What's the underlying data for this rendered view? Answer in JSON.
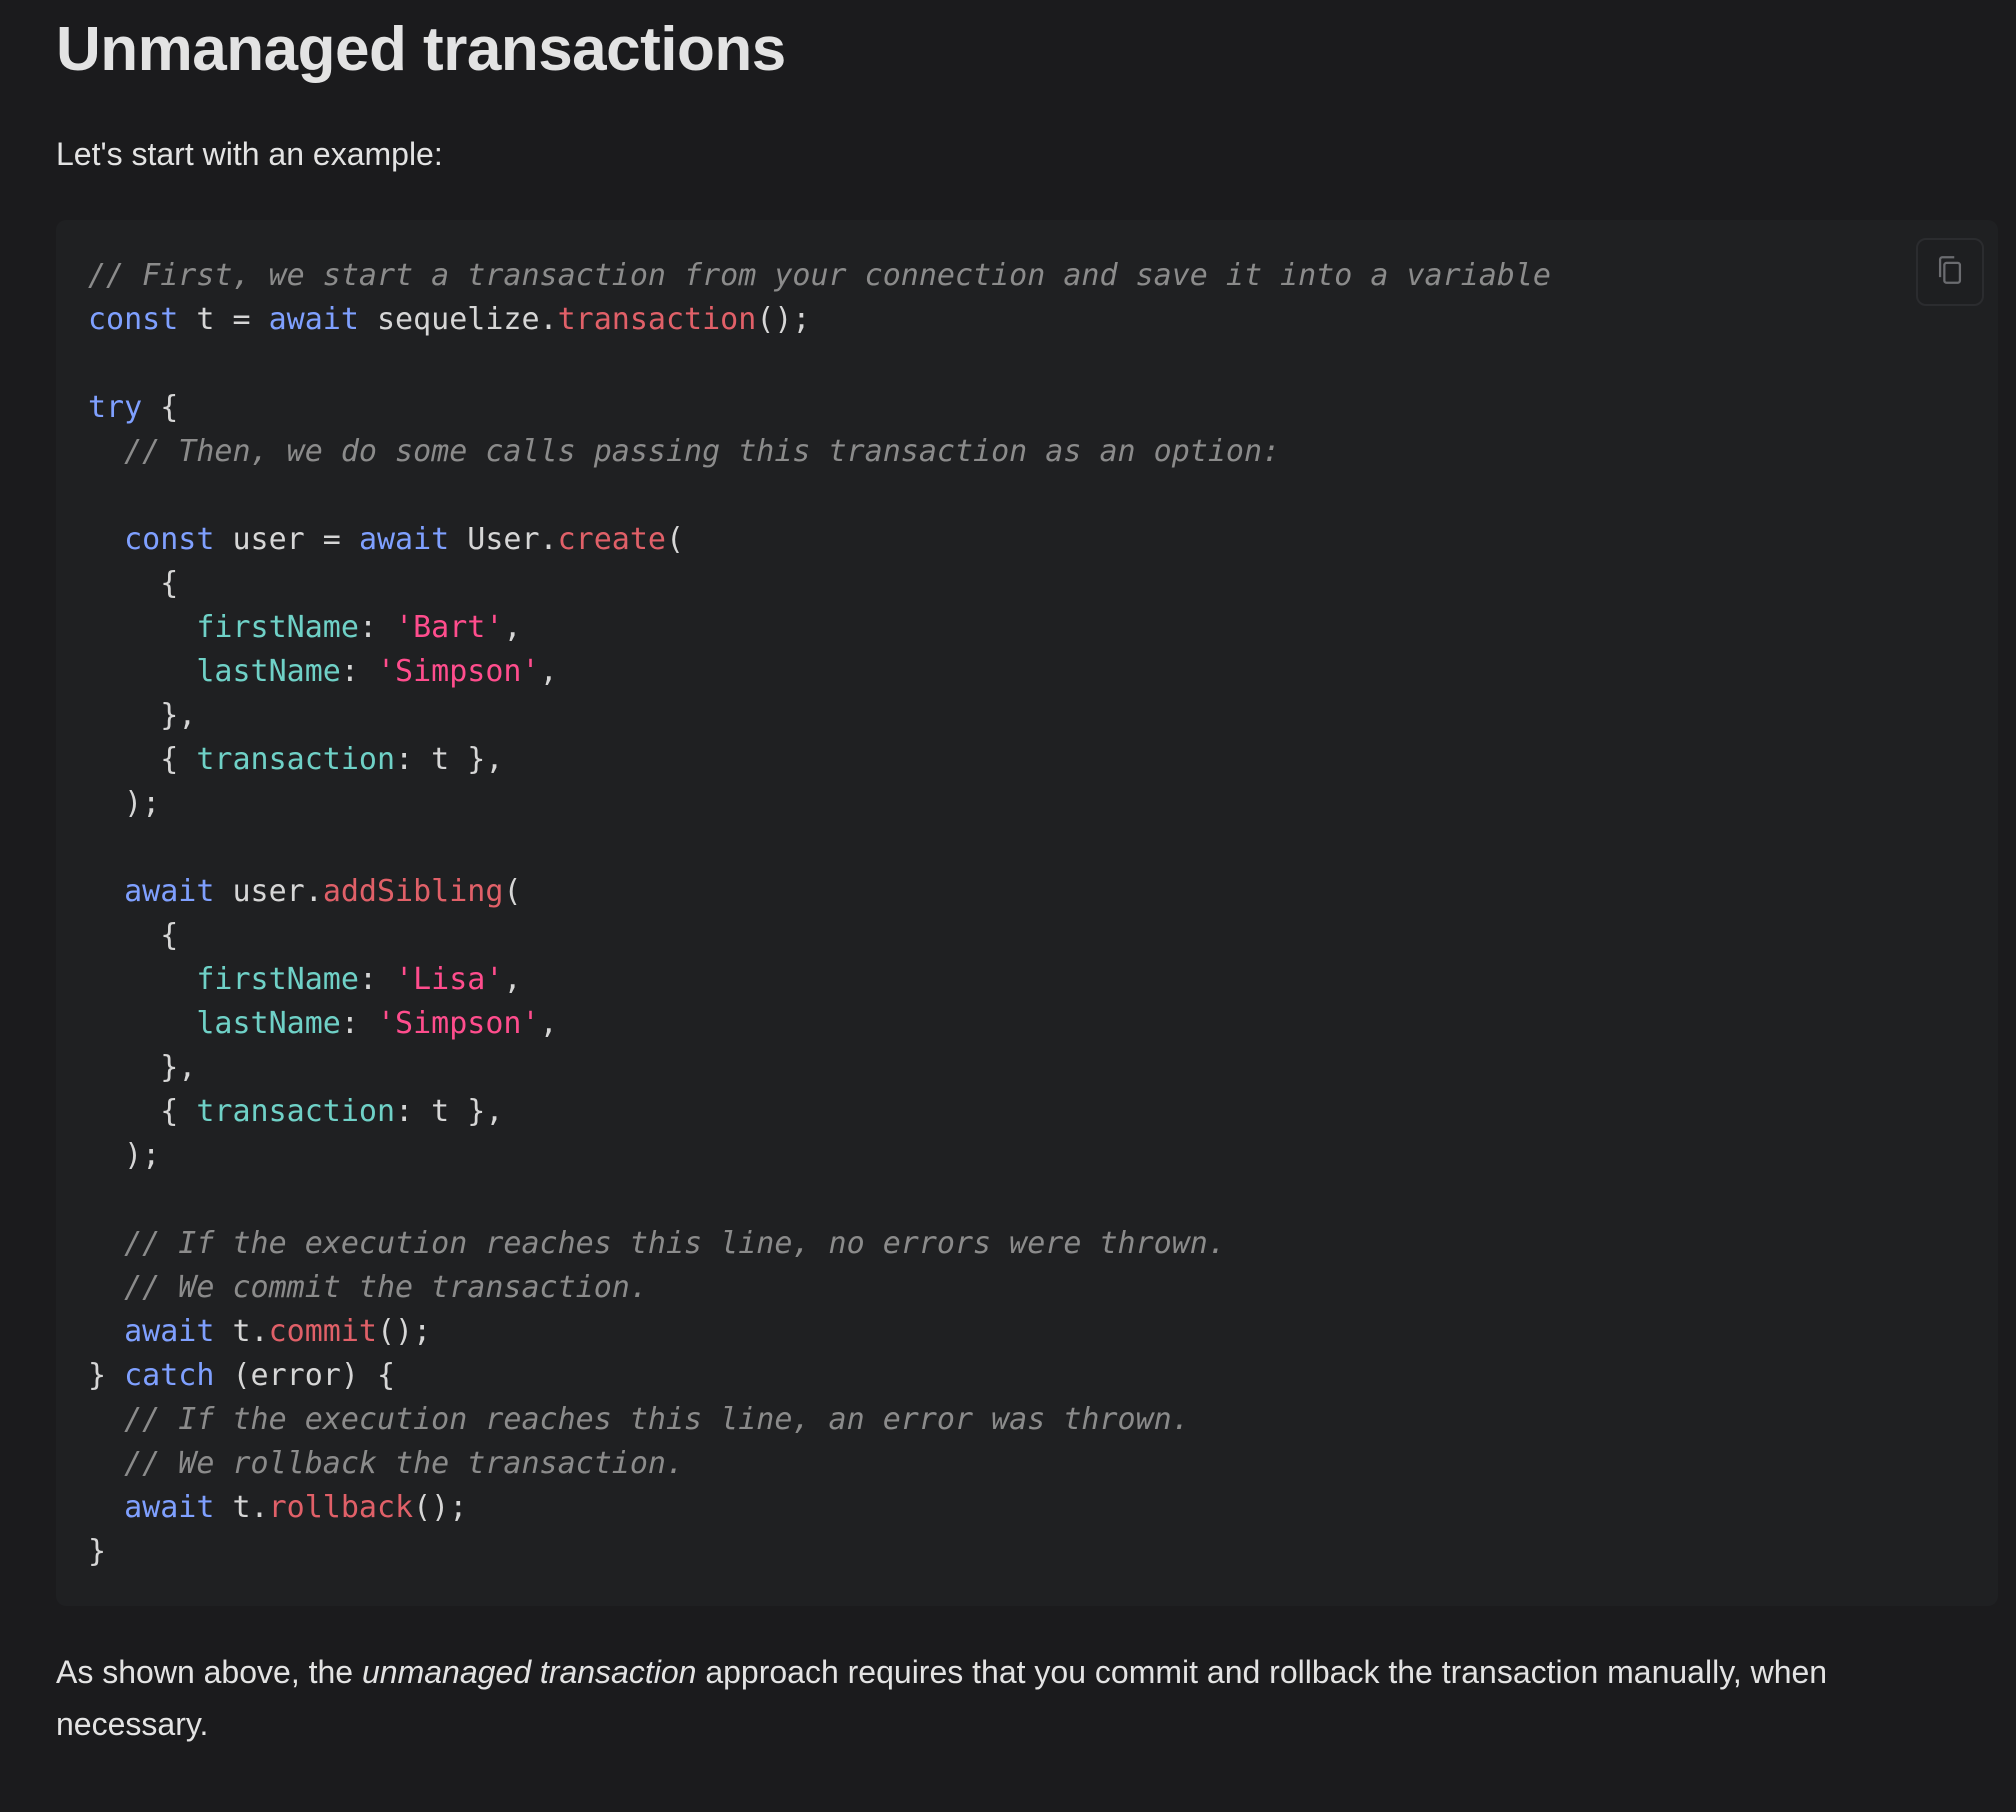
{
  "heading": "Unmanaged transactions",
  "intro": "Let's start with an example:",
  "code": {
    "language": "javascript",
    "copy_icon": "copy-icon",
    "lines": [
      [
        [
          "comment",
          "// First, we start a transaction from your connection and save it into a variable"
        ]
      ],
      [
        [
          "keyword",
          "const"
        ],
        [
          "plain",
          " t = "
        ],
        [
          "keyword",
          "await"
        ],
        [
          "plain",
          " sequelize."
        ],
        [
          "func",
          "transaction"
        ],
        [
          "plain",
          "();"
        ]
      ],
      [],
      [
        [
          "keyword",
          "try"
        ],
        [
          "plain",
          " {"
        ]
      ],
      [
        [
          "plain",
          "  "
        ],
        [
          "comment",
          "// Then, we do some calls passing this transaction as an option:"
        ]
      ],
      [],
      [
        [
          "plain",
          "  "
        ],
        [
          "keyword",
          "const"
        ],
        [
          "plain",
          " user = "
        ],
        [
          "keyword",
          "await"
        ],
        [
          "plain",
          " User."
        ],
        [
          "func",
          "create"
        ],
        [
          "plain",
          "("
        ]
      ],
      [
        [
          "plain",
          "    {"
        ]
      ],
      [
        [
          "plain",
          "      "
        ],
        [
          "prop",
          "firstName"
        ],
        [
          "plain",
          ": "
        ],
        [
          "string",
          "'Bart'"
        ],
        [
          "plain",
          ","
        ]
      ],
      [
        [
          "plain",
          "      "
        ],
        [
          "prop",
          "lastName"
        ],
        [
          "plain",
          ": "
        ],
        [
          "string",
          "'Simpson'"
        ],
        [
          "plain",
          ","
        ]
      ],
      [
        [
          "plain",
          "    },"
        ]
      ],
      [
        [
          "plain",
          "    { "
        ],
        [
          "prop",
          "transaction"
        ],
        [
          "plain",
          ": t },"
        ]
      ],
      [
        [
          "plain",
          "  );"
        ]
      ],
      [],
      [
        [
          "plain",
          "  "
        ],
        [
          "keyword",
          "await"
        ],
        [
          "plain",
          " user."
        ],
        [
          "func",
          "addSibling"
        ],
        [
          "plain",
          "("
        ]
      ],
      [
        [
          "plain",
          "    {"
        ]
      ],
      [
        [
          "plain",
          "      "
        ],
        [
          "prop",
          "firstName"
        ],
        [
          "plain",
          ": "
        ],
        [
          "string",
          "'Lisa'"
        ],
        [
          "plain",
          ","
        ]
      ],
      [
        [
          "plain",
          "      "
        ],
        [
          "prop",
          "lastName"
        ],
        [
          "plain",
          ": "
        ],
        [
          "string",
          "'Simpson'"
        ],
        [
          "plain",
          ","
        ]
      ],
      [
        [
          "plain",
          "    },"
        ]
      ],
      [
        [
          "plain",
          "    { "
        ],
        [
          "prop",
          "transaction"
        ],
        [
          "plain",
          ": t },"
        ]
      ],
      [
        [
          "plain",
          "  );"
        ]
      ],
      [],
      [
        [
          "plain",
          "  "
        ],
        [
          "comment",
          "// If the execution reaches this line, no errors were thrown."
        ]
      ],
      [
        [
          "plain",
          "  "
        ],
        [
          "comment",
          "// We commit the transaction."
        ]
      ],
      [
        [
          "plain",
          "  "
        ],
        [
          "keyword",
          "await"
        ],
        [
          "plain",
          " t."
        ],
        [
          "func",
          "commit"
        ],
        [
          "plain",
          "();"
        ]
      ],
      [
        [
          "plain",
          "} "
        ],
        [
          "keyword",
          "catch"
        ],
        [
          "plain",
          " (error) {"
        ]
      ],
      [
        [
          "plain",
          "  "
        ],
        [
          "comment",
          "// If the execution reaches this line, an error was thrown."
        ]
      ],
      [
        [
          "plain",
          "  "
        ],
        [
          "comment",
          "// We rollback the transaction."
        ]
      ],
      [
        [
          "plain",
          "  "
        ],
        [
          "keyword",
          "await"
        ],
        [
          "plain",
          " t."
        ],
        [
          "func",
          "rollback"
        ],
        [
          "plain",
          "();"
        ]
      ],
      [
        [
          "plain",
          "}"
        ]
      ]
    ]
  },
  "outro": {
    "before": "As shown above, the ",
    "emphasis": "unmanaged transaction",
    "after": " approach requires that you commit and rollback the transaction manually, when necessary."
  },
  "colors": {
    "background": "#1b1b1d",
    "code_background": "#1f2022",
    "keyword": "#7fa0ff",
    "function": "#e06068",
    "property": "#6fd1c7",
    "string": "#ff4d8d",
    "comment": "#8b8b8b"
  }
}
